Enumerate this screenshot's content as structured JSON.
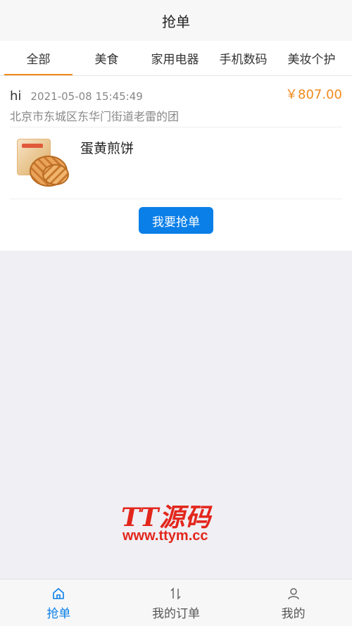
{
  "header": {
    "title": "抢单"
  },
  "tabs": [
    {
      "label": "全部",
      "active": true
    },
    {
      "label": "美食",
      "active": false
    },
    {
      "label": "家用电器",
      "active": false
    },
    {
      "label": "手机数码",
      "active": false
    },
    {
      "label": "美妆个护",
      "active": false
    }
  ],
  "order": {
    "customer": "hi",
    "time": "2021-05-08 15:45:49",
    "price": "￥807.00",
    "address": "北京市东城区东华门街道老雷的团",
    "product_name": "蛋黄煎饼",
    "action_label": "我要抢单"
  },
  "watermark": {
    "title": "TT源码",
    "url": "www.ttym.cc"
  },
  "bottom_nav": [
    {
      "label": "抢单",
      "icon": "home-icon",
      "active": true
    },
    {
      "label": "我的订单",
      "icon": "sort-arrows-icon",
      "active": false
    },
    {
      "label": "我的",
      "icon": "user-icon",
      "active": false
    }
  ],
  "colors": {
    "accent": "#0a7fe8",
    "price": "#f08a1c",
    "tab_indicator": "#f08a1c",
    "watermark": "#e3261c"
  }
}
